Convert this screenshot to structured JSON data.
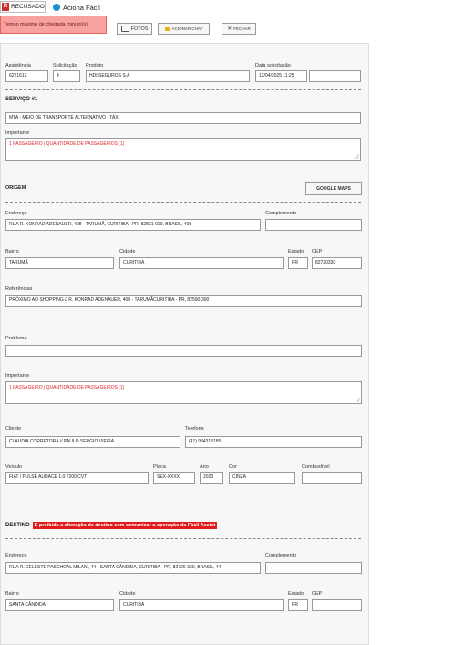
{
  "tabs": {
    "recusado": {
      "badge": "R",
      "label": "RECUSADO",
      "color": "#c9302c"
    },
    "aciona": {
      "label": "Aciona Fácil"
    }
  },
  "alert": {
    "text": "Tempo máximo de chegada minuto(s)"
  },
  "toolbar": {
    "fotos": "FOTOS",
    "chat": "ACIONAR CHAT",
    "fechar": "FECHAR"
  },
  "top": {
    "assistencia_label": "Assistência",
    "assistencia": "6221612",
    "solicitacao_label": "Solicitação",
    "solicitacao": "4",
    "produto_label": "Produto",
    "produto": "HDI SEGUROS S.A",
    "data_label": "Data solicitação",
    "data": "12/04/2025 11:25"
  },
  "servico": {
    "title": "SERVIÇO #1",
    "tipo": "MTA - MEIO DE TRANSPORTE ALTERNATIVO - TAXI",
    "importante_label": "Importante",
    "importante": "1 PASSAGEIRO | QUANTIDADE DE PASSAGEIROS [1]"
  },
  "origem": {
    "title": "ORIGEM",
    "maps": "GOOGLE MAPS",
    "endereco_label": "Endereço",
    "endereco": "RUA R. KONRAD ADENAUER, 408 - TARUMÃ, CURITIBA - PR, 82821-020, BRASIL, 408",
    "complemento_label": "Complemento",
    "complemento": "",
    "bairro_label": "Bairro",
    "bairro": "TARUMÃ",
    "cidade_label": "Cidade",
    "cidade": "CURITIBA",
    "estado_label": "Estado",
    "estado": "PR",
    "cep_label": "CEP",
    "cep": "82720330",
    "referencias_label": "Referências",
    "referencias": "PRÓXIMO AO SHOPPING  // R. KONRAD ADENAUER, 408 - TARUMÃCURITIBA - PR, 82590-300"
  },
  "detalhes": {
    "problema_label": "Problema",
    "problema": "",
    "importante_label": "Importante",
    "importante": "1 PASSAGEIRO | QUANTIDADE DE PASSAGEIROS [1]",
    "cliente_label": "Cliente",
    "cliente": "CLAUDIA CORRETORA // PAULO SERGIO VIEIRA",
    "telefone_label": "Telefone",
    "telefone": "(41) 984313185",
    "veiculo_label": "Veículo",
    "veiculo": "FIAT / PULSE AUDACE 1.0 T200 CVT",
    "placa_label": "Placa",
    "placa": "SEX-XXXX",
    "ano_label": "Ano",
    "ano": "2023",
    "cor_label": "Cor",
    "cor": "CINZA",
    "combustivel_label": "Combustível",
    "combustivel": ""
  },
  "destino": {
    "title": "DESTINO",
    "warning": "É proibida a alteração de destino sem comunicar a operação da Fácil Assist",
    "endereco_label": "Endereço",
    "endereco": "RUA R. CELESTE PASCHOAL MILANI, 44 - SANTA CÂNDIDA, CURITIBA - PR, 82720-330, BRASIL, 44",
    "complemento_label": "Complemento",
    "complemento": "",
    "bairro_label": "Bairro",
    "bairro": "SANTA CÂNDIDA",
    "cidade_label": "Cidade",
    "cidade": "CURITIBA",
    "estado_label": "Estado",
    "estado": "PR",
    "cep_label": "CEP",
    "cep": ""
  },
  "colors": {
    "accent_red": "#d9232a",
    "alert_bg": "#f7a1a1",
    "panel_bg": "#f7f7f7"
  }
}
